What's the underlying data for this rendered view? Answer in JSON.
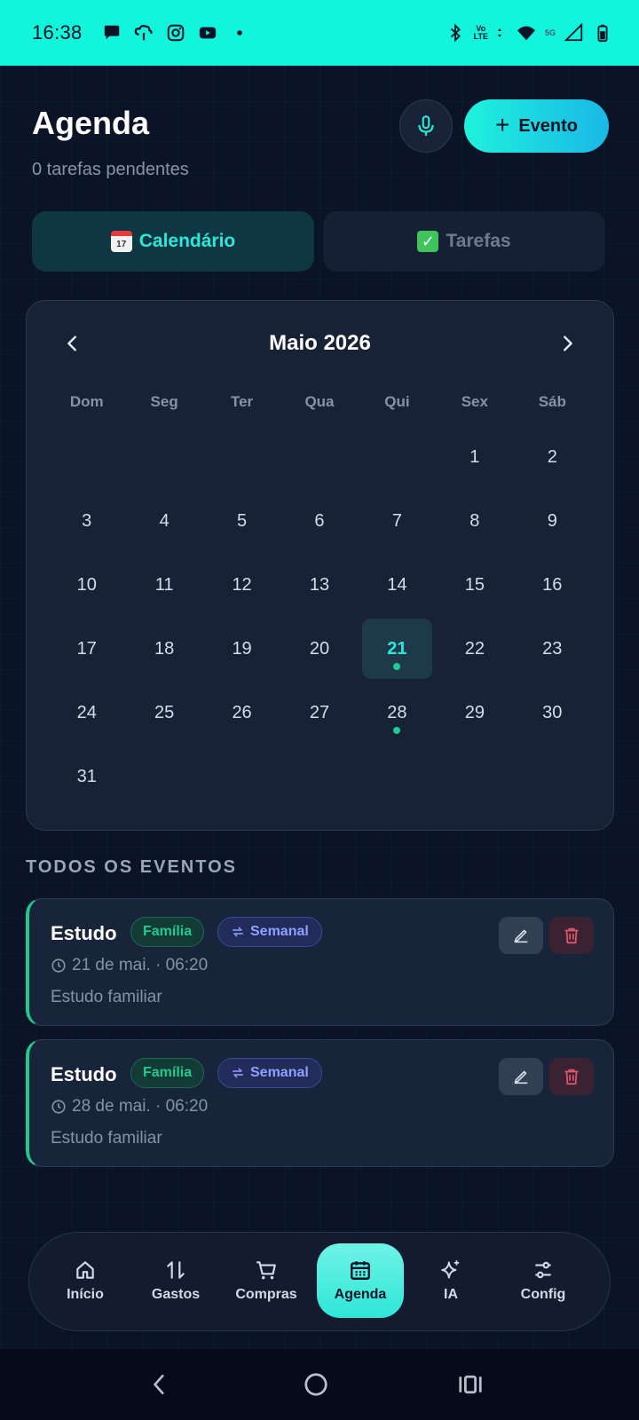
{
  "status_bar": {
    "time": "16:38",
    "network_lines": [
      "Vo",
      "LTE"
    ],
    "network_5g": "5G"
  },
  "header": {
    "title": "Agenda",
    "subtitle": "0 tarefas pendentes",
    "add_event_label": "Evento"
  },
  "tabs": [
    {
      "label": "Calendário",
      "emoji_text": "17",
      "active": true
    },
    {
      "label": "Tarefas",
      "active": false
    }
  ],
  "calendar": {
    "month_label": "Maio 2026",
    "weekdays": [
      "Dom",
      "Seg",
      "Ter",
      "Qua",
      "Qui",
      "Sex",
      "Sáb"
    ],
    "first_weekday_index": 5,
    "days_in_month": 31,
    "selected_day": 21,
    "days_with_events": [
      21,
      28
    ]
  },
  "events_section": {
    "title": "TODOS OS EVENTOS",
    "events": [
      {
        "title": "Estudo",
        "category": "Família",
        "recurrence": "Semanal",
        "datetime": "21 de mai. · 06:20",
        "description": "Estudo familiar"
      },
      {
        "title": "Estudo",
        "category": "Família",
        "recurrence": "Semanal",
        "datetime": "28 de mai. · 06:20",
        "description": "Estudo familiar"
      }
    ]
  },
  "bottom_nav": {
    "items": [
      {
        "label": "Início",
        "icon": "home-icon",
        "active": false
      },
      {
        "label": "Gastos",
        "icon": "arrows-up-down-icon",
        "active": false
      },
      {
        "label": "Compras",
        "icon": "cart-icon",
        "active": false
      },
      {
        "label": "Agenda",
        "icon": "calendar-icon",
        "active": true
      },
      {
        "label": "IA",
        "icon": "sparkles-icon",
        "active": false
      },
      {
        "label": "Config",
        "icon": "sliders-icon",
        "active": false
      }
    ]
  },
  "colors": {
    "accent": "#2ee6d8",
    "status_bar": "#12f4dc",
    "background": "#0b1426",
    "event_dot": "#1fc98f",
    "recurrence": "#8fa1ff",
    "delete": "#e0566a"
  }
}
